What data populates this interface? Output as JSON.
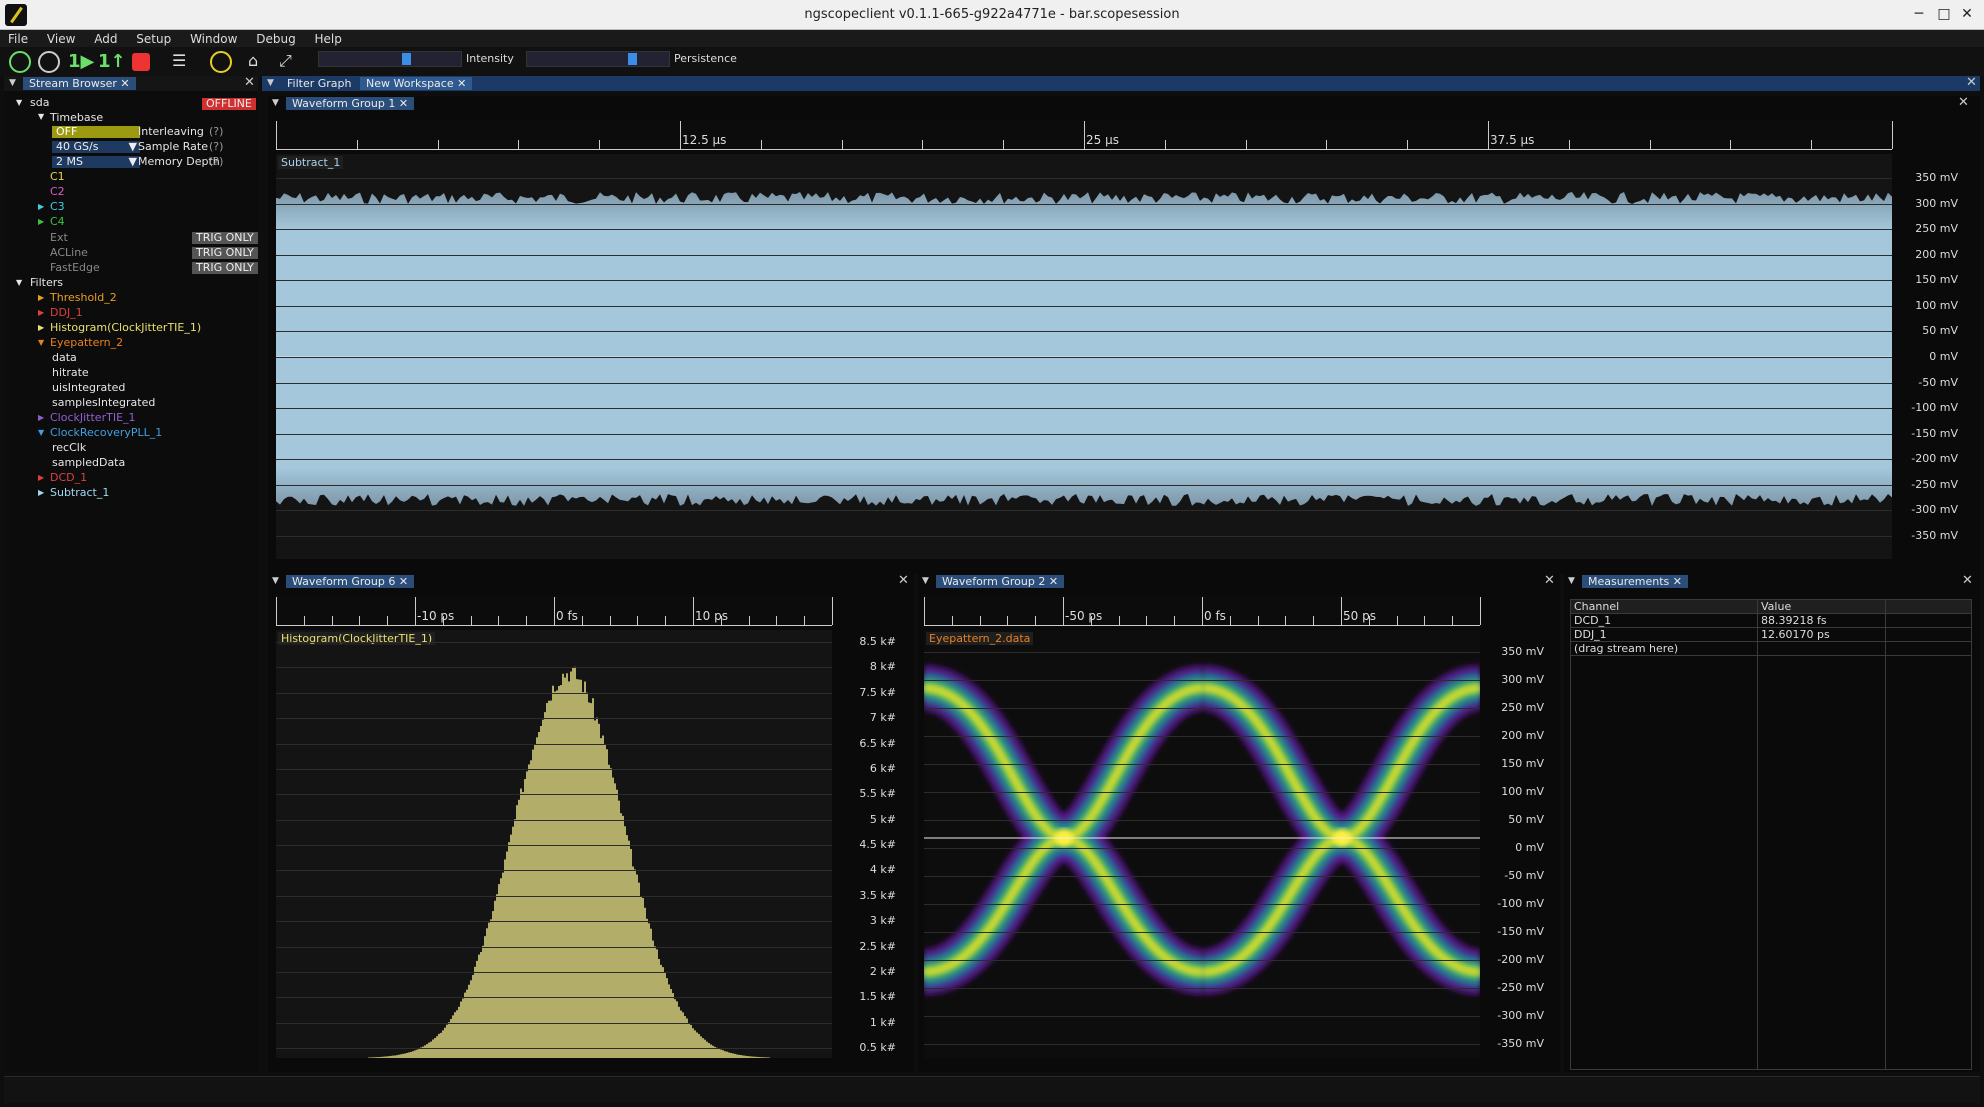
{
  "window": {
    "title": "ngscopeclient v0.1.1-665-g922a4771e - bar.scopesession"
  },
  "menu": [
    "File",
    "View",
    "Add",
    "Setup",
    "Window",
    "Debug",
    "Help"
  ],
  "toolbar": {
    "intensity_label": "Intensity",
    "intensity_value": 0.62,
    "persistence_label": "Persistence",
    "persistence_value": 0.75
  },
  "stream_browser": {
    "tab": "Stream Browser",
    "instrument": "sda",
    "status": "OFFLINE",
    "timebase_label": "Timebase",
    "interleaving": {
      "value": "OFF",
      "label": "Interleaving",
      "help": "(?)"
    },
    "sample_rate": {
      "value": "40 GS/s",
      "label": "Sample Rate",
      "help": "(?)"
    },
    "memory_depth": {
      "value": "2 MS",
      "label": "Memory Depth",
      "help": "(?)"
    },
    "channels": [
      {
        "name": "C1",
        "color": "#e8d44d"
      },
      {
        "name": "C2",
        "color": "#e05ac8"
      },
      {
        "name": "C3",
        "color": "#40d0e0"
      },
      {
        "name": "C4",
        "color": "#40c040"
      }
    ],
    "trig_inputs": [
      {
        "name": "Ext",
        "badge": "TRIG ONLY"
      },
      {
        "name": "ACLine",
        "badge": "TRIG ONLY"
      },
      {
        "name": "FastEdge",
        "badge": "TRIG ONLY"
      }
    ],
    "filters_label": "Filters",
    "filters": [
      {
        "name": "Threshold_2",
        "color": "#e8a020",
        "expanded": false
      },
      {
        "name": "DDJ_1",
        "color": "#e04040",
        "expanded": false
      },
      {
        "name": "Histogram(ClockJitterTIE_1)",
        "color": "#e8e070",
        "expanded": false
      },
      {
        "name": "Eyepattern_2",
        "color": "#e88020",
        "expanded": true,
        "children": [
          "data",
          "hitrate",
          "uisIntegrated",
          "samplesIntegrated"
        ]
      },
      {
        "name": "ClockJitterTIE_1",
        "color": "#9060d0",
        "expanded": false
      },
      {
        "name": "ClockRecoveryPLL_1",
        "color": "#40a0e0",
        "expanded": true,
        "children": [
          "recClk",
          "sampledData"
        ]
      },
      {
        "name": "DCD_1",
        "color": "#e04040",
        "expanded": false
      },
      {
        "name": "Subtract_1",
        "color": "#a0d8f0",
        "expanded": false
      }
    ]
  },
  "workspace_tabs": [
    "Filter Graph",
    "New Workspace"
  ],
  "group1": {
    "tab": "Waveform Group 1",
    "time_labels": [
      "12.5 µs",
      "25 µs",
      "37.5 µs"
    ],
    "trace": "Subtract_1",
    "trace_color": "#a9d3ea",
    "y_labels": [
      "350 mV",
      "300 mV",
      "250 mV",
      "200 mV",
      "150 mV",
      "100 mV",
      "50 mV",
      "0 mV",
      "-50 mV",
      "-100 mV",
      "-150 mV",
      "-200 mV",
      "-250 mV",
      "-300 mV",
      "-350 mV"
    ]
  },
  "group6": {
    "tab": "Waveform Group 6",
    "time_labels": [
      "-10 ps",
      "0 fs",
      "10 ps"
    ],
    "trace": "Histogram(ClockJitterTIE_1)",
    "trace_color": "#e8e070",
    "y_labels": [
      "8.5 k#",
      "8 k#",
      "7.5 k#",
      "7 k#",
      "6.5 k#",
      "6 k#",
      "5.5 k#",
      "5 k#",
      "4.5 k#",
      "4 k#",
      "3.5 k#",
      "3 k#",
      "2.5 k#",
      "2 k#",
      "1.5 k#",
      "1 k#",
      "0.5 k#"
    ]
  },
  "group2": {
    "tab": "Waveform Group 2",
    "time_labels": [
      "-50 ps",
      "0 fs",
      "50 ps"
    ],
    "trace": "Eyepattern_2.data",
    "trace_color": "#e88020",
    "y_labels": [
      "350 mV",
      "300 mV",
      "250 mV",
      "200 mV",
      "150 mV",
      "100 mV",
      "50 mV",
      "0 mV",
      "-50 mV",
      "-100 mV",
      "-150 mV",
      "-200 mV",
      "-250 mV",
      "-300 mV",
      "-350 mV"
    ]
  },
  "measurements": {
    "tab": "Measurements",
    "headers": [
      "Channel",
      "Value"
    ],
    "rows": [
      {
        "channel": "DCD_1",
        "value": "88.39218 fs"
      },
      {
        "channel": "DDJ_1",
        "value": "12.60170 ps"
      }
    ],
    "hint": "(drag stream here)"
  }
}
